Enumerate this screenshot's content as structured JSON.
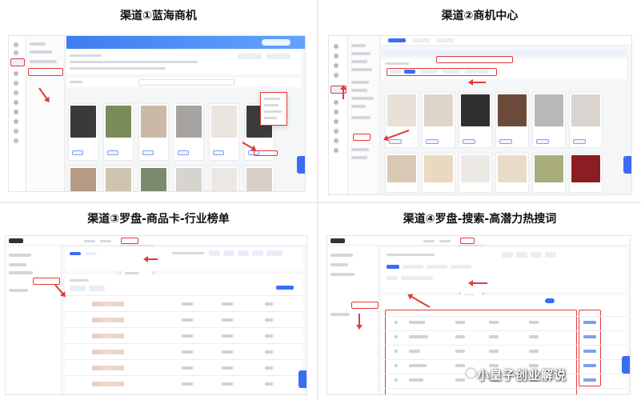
{
  "panels": [
    {
      "title": "渠道①蓝海商机"
    },
    {
      "title": "渠道②商机中心"
    },
    {
      "title": "渠道③罗盘-商品卡-行业榜单"
    },
    {
      "title": "渠道④罗盘-搜索-高潜力热搜词"
    }
  ],
  "watermark": {
    "text": "小皇子创业解说",
    "icon": "logo-circle-icon"
  },
  "colors": {
    "accent": "#3b6cf4",
    "highlight": "#e23a3a",
    "divider": "#ececec"
  }
}
